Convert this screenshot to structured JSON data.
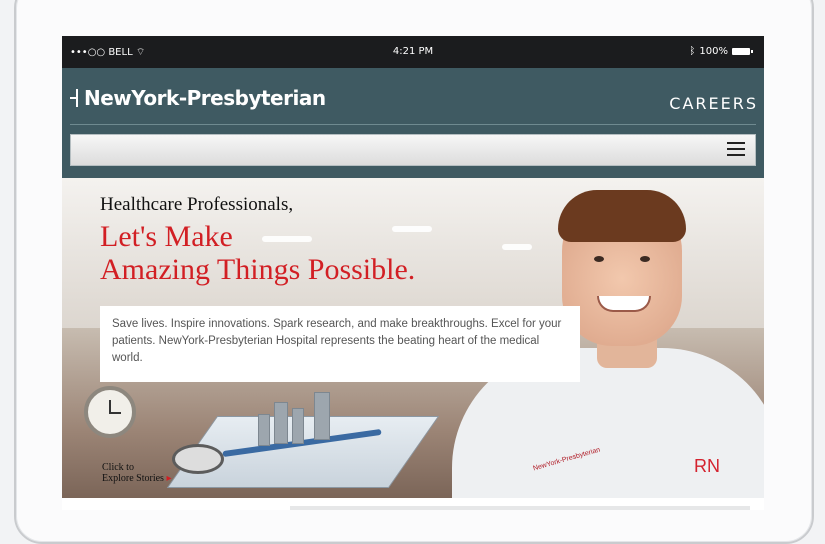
{
  "statusbar": {
    "carrier": "•••○○ BELL ",
    "wifi_icon": "wifi-icon",
    "time": "4:21 PM",
    "bluetooth_icon": "bluetooth-icon",
    "battery_pct": "100%",
    "battery_icon": "battery-icon"
  },
  "header": {
    "logo_text": "NewYork-Presbyterian",
    "section_title": "CAREERS"
  },
  "nav": {
    "menu_icon": "hamburger-icon"
  },
  "hero": {
    "heading_line1": "Healthcare Professionals,",
    "heading_line2": "Let's Make",
    "heading_line3": "Amazing Things Possible.",
    "body_text": "Save lives. Inspire innovations. Spark research, and make breakthroughs. Excel for your patients. NewYork-Presbyterian Hospital represents the beating heart of the medical world.",
    "explore_line1": "Click to",
    "explore_line2": "Explore Stories",
    "badge_rn": "RN",
    "scrub_logo_text": "NewYork-Presbyterian",
    "colors": {
      "header_bg": "#3f5a62",
      "accent_red": "#d21f24"
    }
  }
}
